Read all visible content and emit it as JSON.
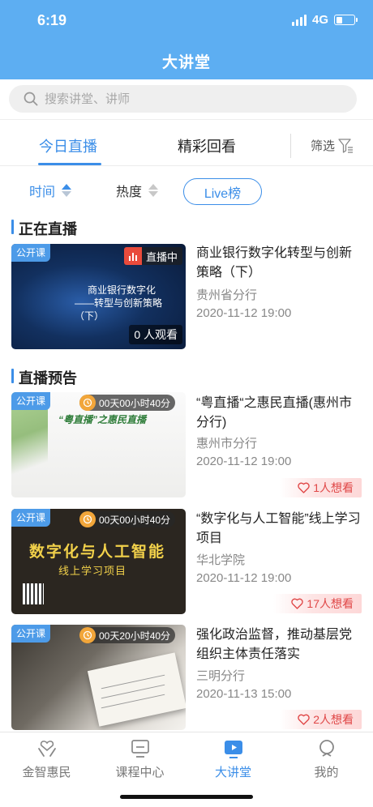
{
  "status_bar": {
    "time": "6:19",
    "network": "4G",
    "battery_level": 0.35
  },
  "header": {
    "title": "大讲堂"
  },
  "search": {
    "placeholder": "搜索讲堂、讲师"
  },
  "tabs": {
    "live": "今日直播",
    "replay": "精彩回看",
    "active": "live",
    "filter": "筛选"
  },
  "sort": {
    "time": "时间",
    "heat": "热度",
    "live_rank": "Live榜",
    "active": "time"
  },
  "sections": {
    "live_now": "正在直播",
    "upcoming": "直播预告"
  },
  "live_card": {
    "badge": "公开课",
    "live_label": "直播中",
    "viewers": "0 人观看",
    "thumb_text_line1": "商业银行数字化",
    "thumb_text_line2": "——转型与创新策略（下）",
    "title": "商业银行数字化转型与创新策略（下）",
    "org": "贵州省分行",
    "time": "2020-11-12 19:00"
  },
  "upcoming_cards": [
    {
      "badge": "公开课",
      "countdown": "00天00小时40分",
      "thumb_main": "“粤直播”之惠民直播",
      "title": "“粤直播“之惠民直播(惠州市分行)",
      "org": "惠州市分行",
      "time": "2020-11-12 19:00",
      "want": "1人想看"
    },
    {
      "badge": "公开课",
      "countdown": "00天00小时40分",
      "thumb_main": "数字化与人工智能",
      "thumb_sub": "线上学习项目",
      "title": "“数字化与人工智能”线上学习项目",
      "org": "华北学院",
      "time": "2020-11-12 19:00",
      "want": "17人想看"
    },
    {
      "badge": "公开课",
      "countdown": "00天20小时40分",
      "title": "强化政治监督，推动基层党组织主体责任落实",
      "org": "三明分行",
      "time": "2020-11-13 15:00",
      "want": "2人想看"
    }
  ],
  "tabbar": [
    {
      "label": "金智惠民",
      "icon": "hands-heart-icon"
    },
    {
      "label": "课程中心",
      "icon": "monitor-icon"
    },
    {
      "label": "大讲堂",
      "icon": "video-play-icon"
    },
    {
      "label": "我的",
      "icon": "user-icon"
    }
  ],
  "colors": {
    "header": "#5daef2",
    "accent": "#3b8ee8",
    "live_red": "#e94b3c",
    "want_red": "#e04848"
  }
}
